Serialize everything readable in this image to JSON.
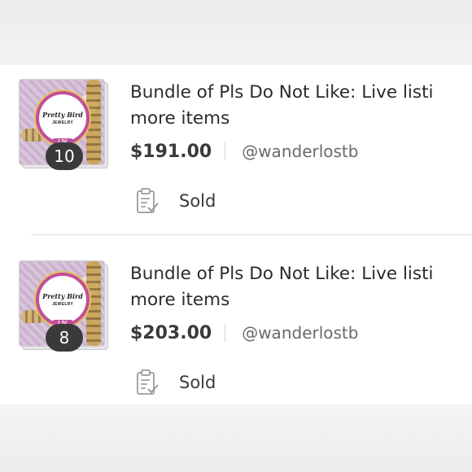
{
  "listings": [
    {
      "title_line1": "Bundle of Pls Do Not Like: Live listi",
      "title_line2": "more items",
      "price": "$191.00",
      "seller": "@wanderlostb",
      "item_count": "10",
      "status": "Sold",
      "status_icon": "clipboard-check-icon",
      "logo_text": "Pretty Bird",
      "logo_subtext": "JEWELRY",
      "tag_text": "LIV"
    },
    {
      "title_line1": "Bundle of Pls Do Not Like: Live listi",
      "title_line2": "more items",
      "price": "$203.00",
      "seller": "@wanderlostb",
      "item_count": "8",
      "status": "Sold",
      "status_icon": "clipboard-check-icon",
      "logo_text": "Pretty Bird",
      "logo_subtext": "JEWELRY",
      "tag_text": "LIV"
    }
  ],
  "colors": {
    "brand_magenta": "#c04f9b",
    "badge_bg": "#3a3a3a",
    "text_primary": "#2b2b2b",
    "text_secondary": "#6a6a6a"
  }
}
